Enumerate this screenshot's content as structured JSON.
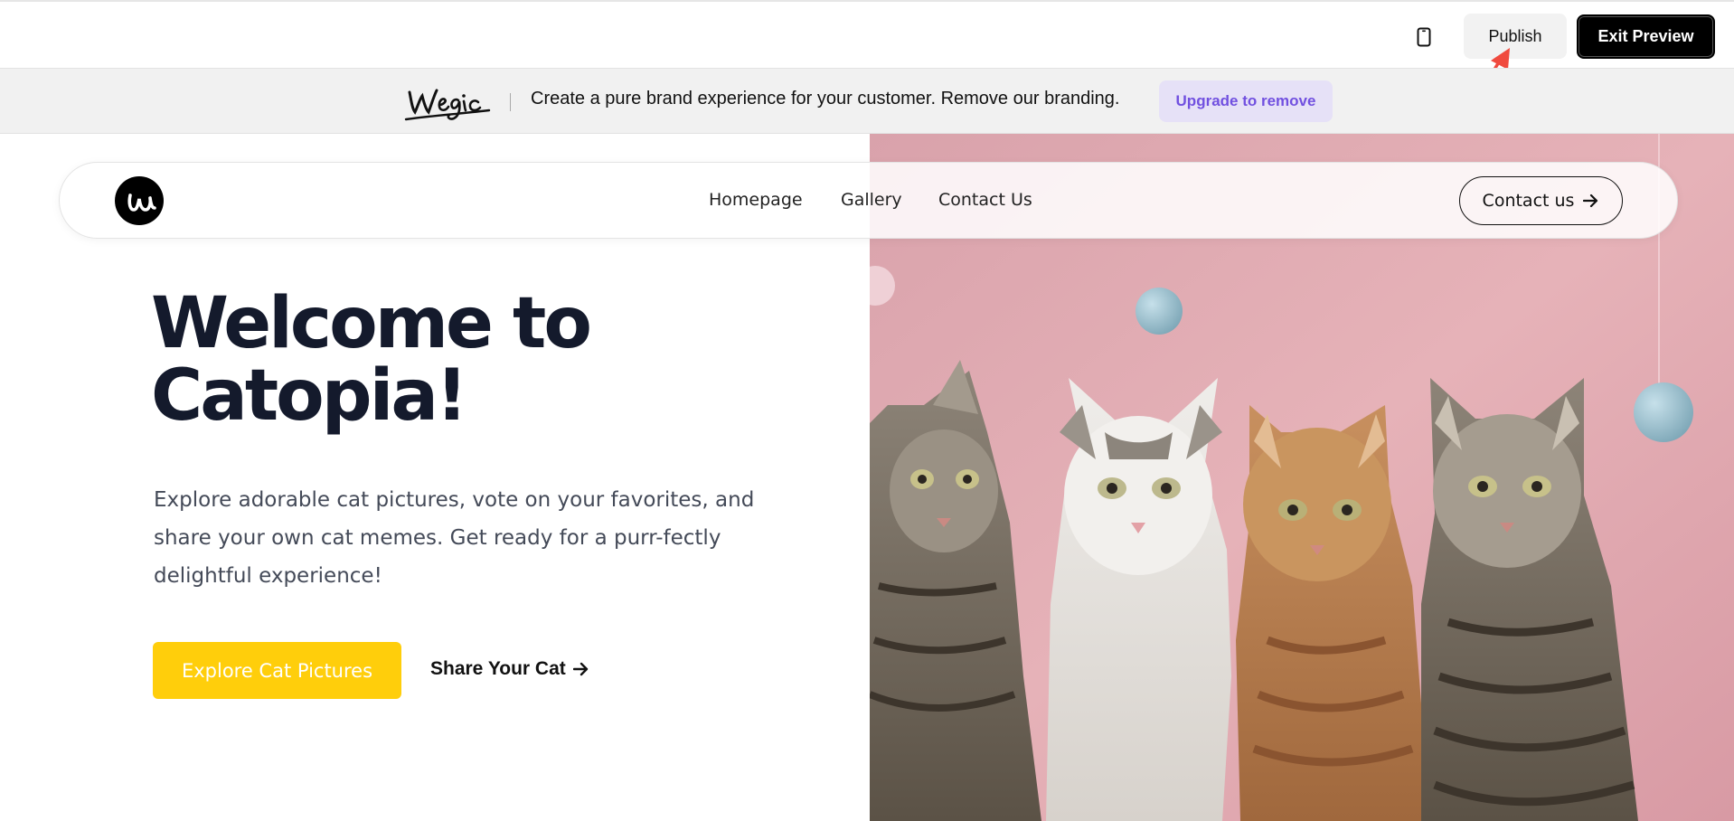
{
  "toolbar": {
    "device_icon": "mobile-phone-icon",
    "publish_label": "Publish",
    "exit_label": "Exit Preview"
  },
  "banner": {
    "logo_text": "wegic",
    "message": "Create a pure brand experience for your customer. Remove our branding.",
    "upgrade_label": "Upgrade to remove",
    "accent_color": "#7150e0"
  },
  "nav": {
    "links": [
      "Homepage",
      "Gallery",
      "Contact Us"
    ],
    "contact_label": "Contact us",
    "contact_icon": "arrow-right-icon"
  },
  "hero": {
    "title_line1": "Welcome to",
    "title_line2": "Catopia!",
    "description": "Explore adorable cat pictures, vote on your favorites, and share your own cat memes. Get ready for a purr-fectly delightful experience!",
    "primary_label": "Explore Cat Pictures",
    "secondary_label": "Share Your Cat",
    "primary_color": "#ffce0b",
    "image_subject": "four tabby cats sitting against a pink wall"
  }
}
